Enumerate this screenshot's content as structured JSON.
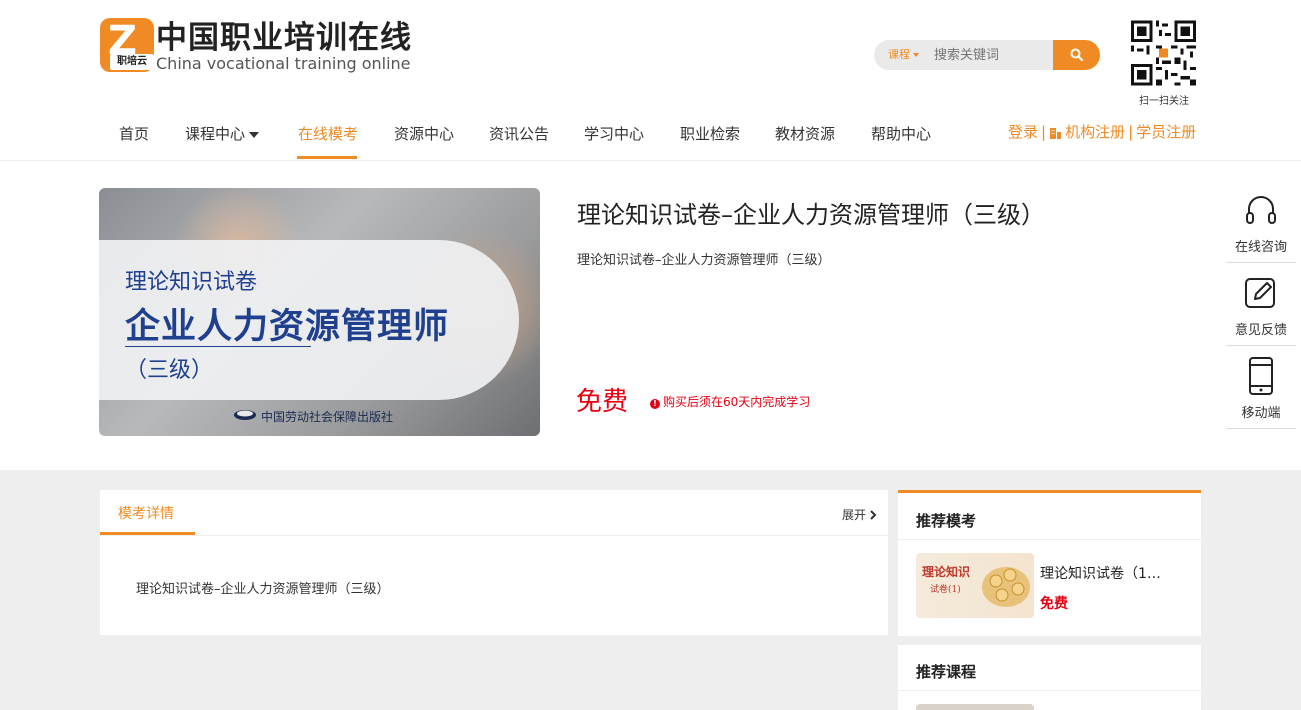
{
  "logo": {
    "cn": "中国职业培训在线",
    "en": "China vocational training online",
    "mark": "Z",
    "mark_sub": "职培云"
  },
  "search": {
    "category": "课程",
    "placeholder": "搜索关键词",
    "icon": "search-icon"
  },
  "qr": {
    "caption": "扫一扫关注"
  },
  "nav": {
    "items": [
      {
        "label": "首页"
      },
      {
        "label": "课程中心"
      },
      {
        "label": "在线模考"
      },
      {
        "label": "资源中心"
      },
      {
        "label": "资讯公告"
      },
      {
        "label": "学习中心"
      },
      {
        "label": "职业检索"
      },
      {
        "label": "教材资源"
      },
      {
        "label": "帮助中心"
      }
    ],
    "active": "在线模考"
  },
  "auth": {
    "login": "登录",
    "org_register": "机构注册",
    "student_register": "学员注册"
  },
  "product": {
    "cover": {
      "line1": "理论知识试卷",
      "line2": "企业人力资源管理师",
      "line3": "（三级）",
      "publisher": "中国劳动社会保障出版社"
    },
    "title": "理论知识试卷–企业人力资源管理师（三级）",
    "subtitle": "理论知识试卷–企业人力资源管理师（三级）",
    "price": "免费",
    "note": "购买后须在60天内完成学习"
  },
  "float_bar": {
    "items": [
      {
        "label": "在线咨询",
        "icon": "headset-icon"
      },
      {
        "label": "意见反馈",
        "icon": "edit-icon"
      },
      {
        "label": "移动端",
        "icon": "mobile-icon"
      }
    ]
  },
  "details": {
    "tab": "模考详情",
    "expand": "展开",
    "body": "理论知识试卷–企业人力资源管理师（三级）"
  },
  "recommend": {
    "heading": "推荐模考",
    "item": {
      "thumb_line1": "理论知识",
      "thumb_line2": "试卷(1)",
      "name": "理论知识试卷（1…",
      "price": "免费"
    },
    "courses_heading": "推荐课程"
  },
  "colors": {
    "accent": "#f08a24",
    "price": "#e60012",
    "cover_text": "#1f3f8f"
  }
}
